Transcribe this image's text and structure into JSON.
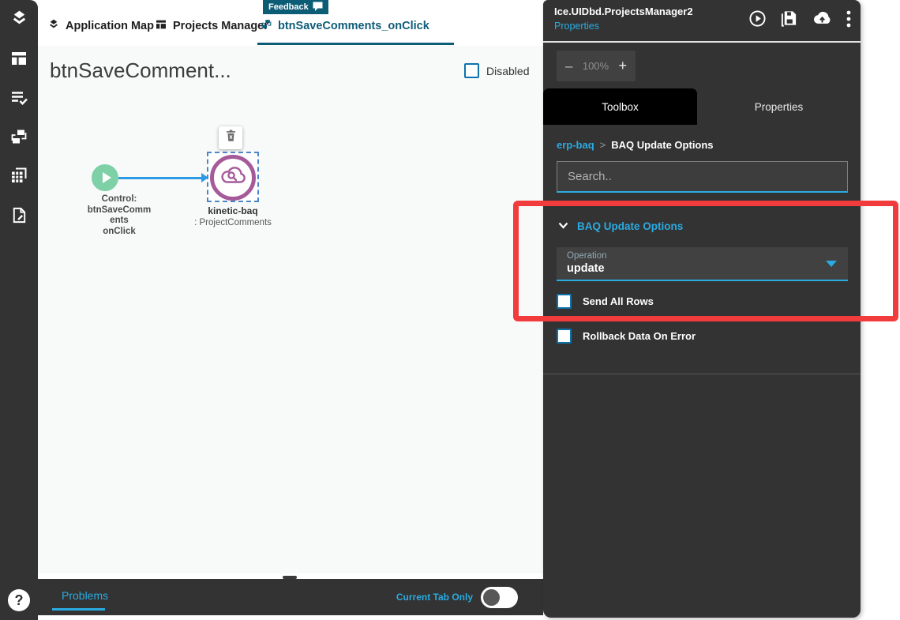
{
  "window": {
    "feedback_label": "Feedback",
    "help_glyph": "?"
  },
  "top_tabs": {
    "items": [
      {
        "label": "Application Map"
      },
      {
        "label": "Projects Manager"
      },
      {
        "label": "btnSaveComments_onClick"
      }
    ]
  },
  "canvas": {
    "title": "btnSaveComment...",
    "disabled_label": "Disabled",
    "flow": {
      "start_lines": [
        "Control:",
        "btnSaveComm",
        "ents",
        "onClick"
      ],
      "node_title": "kinetic-baq",
      "node_subtitle": ": ProjectComments"
    }
  },
  "problems_bar": {
    "tab_label": "Problems",
    "toggle_label": "Current Tab Only"
  },
  "right_panel": {
    "title": "Ice.UIDbd.ProjectsManager2",
    "subtitle_link": "Properties",
    "zoom": {
      "minus": "–",
      "value": "100%",
      "plus": "+"
    },
    "tabs": {
      "toolbox": "Toolbox",
      "properties": "Properties"
    },
    "breadcrumb": {
      "root": "erp-baq",
      "separator": ">",
      "current": "BAQ Update Options"
    },
    "search": {
      "placeholder": "Search.."
    },
    "section_title": "BAQ Update Options",
    "operation": {
      "label": "Operation",
      "value": "update"
    },
    "checkbox_send_all_rows": "Send All Rows",
    "checkbox_rollback": "Rollback Data On Error"
  },
  "colors": {
    "accent_blue": "#29ABE2",
    "teal": "#0D5C75",
    "panel_dark": "#333333",
    "toolbox_tab_bg": "#000000",
    "annotation_red": "#F23B3D",
    "node_purple": "#A55B9A",
    "start_green": "#7ED0A6",
    "arrow_blue": "#2B9BE5",
    "checkbox_border": "#0D72AB"
  }
}
